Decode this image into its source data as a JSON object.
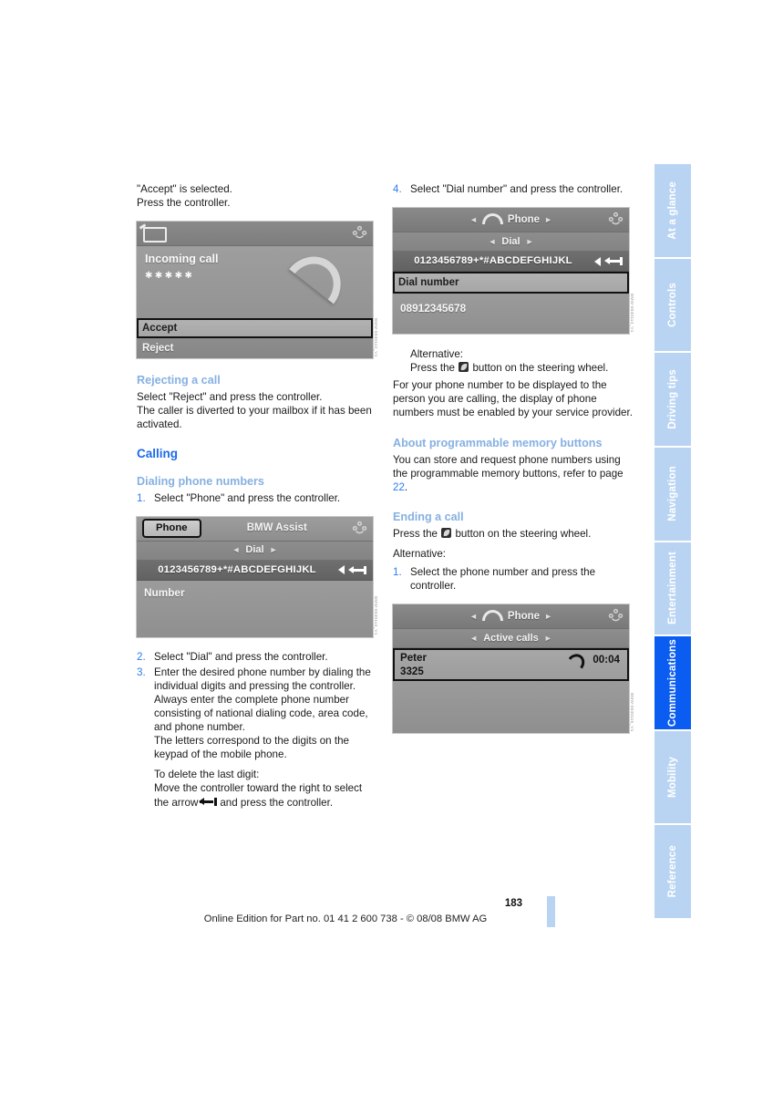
{
  "document": {
    "page_number": "183",
    "footer_text": "Online Edition for Part no. 01 41 2 600 738 - © 08/08 BMW AG"
  },
  "side_tabs": [
    {
      "label": "At a glance",
      "active": false
    },
    {
      "label": "Controls",
      "active": false
    },
    {
      "label": "Driving tips",
      "active": false
    },
    {
      "label": "Navigation",
      "active": false
    },
    {
      "label": "Entertainment",
      "active": false
    },
    {
      "label": "Communications",
      "active": true
    },
    {
      "label": "Mobility",
      "active": false
    },
    {
      "label": "Reference",
      "active": false
    }
  ],
  "colors": {
    "heading_major": "#1b6be8",
    "heading_minor": "#86b0e2",
    "step_number": "#2c7bf0",
    "tab_inactive": "#b9d4f3",
    "tab_active": "#0a5df0"
  },
  "left_column": {
    "intro_line_1": "\"Accept\" is selected.",
    "intro_line_2": "Press the controller.",
    "incoming_call_screen": {
      "title": "Incoming call",
      "masked_number": "✱✱✱✱✱",
      "row_accept": "Accept",
      "row_reject": "Reject",
      "credit": "BMW-0040112_V1"
    },
    "rejecting_heading": "Rejecting a call",
    "rejecting_body_1": "Select \"Reject\" and press the controller.",
    "rejecting_body_2": "The caller is diverted to your mailbox if it has been activated.",
    "calling_heading": "Calling",
    "dialing_heading": "Dialing phone numbers",
    "step1_num": "1.",
    "step1_text": "Select \"Phone\" and press the controller.",
    "dial_screen": {
      "tab_phone": "Phone",
      "label_bmw_assist": "BMW Assist",
      "subbar": "Dial",
      "charstrip": "0123456789+*#ABCDEFGHIJKL",
      "field_label": "Number",
      "credit": "BMW-0040113_V1"
    },
    "step2_num": "2.",
    "step2_text": "Select \"Dial\" and press the controller.",
    "step3_num": "3.",
    "step3_text": "Enter the desired phone number by dialing the individual digits and pressing the controller.",
    "step3_para2": "Always enter the complete phone number consisting of national dialing code, area code, and phone number.",
    "step3_para3": "The letters correspond to the digits on the keypad of the mobile phone.",
    "step3_para4_line1": "To delete the last digit:",
    "step3_para4_line2_a": "Move the controller toward the right to select the arrow",
    "step3_para4_line2_b": "and press the controller."
  },
  "right_column": {
    "step4_num": "4.",
    "step4_text": "Select \"Dial number\" and press the controller.",
    "dial_number_screen": {
      "topbar_title": "Phone",
      "subbar": "Dial",
      "charstrip": "0123456789+*#ABCDEFGHIJKL",
      "selected_row": "Dial number",
      "entered_number": "08912345678",
      "credit": "BMW-0040114_V1"
    },
    "alternative_label": "Alternative:",
    "alternative_text_a": "Press the",
    "alternative_text_b": "button on the steering wheel.",
    "display_note": "For your phone number to be displayed to the person you are calling, the display of phone numbers must be enabled by your service provider.",
    "memory_heading": "About programmable memory buttons",
    "memory_body_a": "You can store and request phone numbers using the programmable memory buttons, refer to page",
    "memory_page_ref": "22",
    "ending_heading": "Ending a call",
    "ending_text_a": "Press the",
    "ending_text_b": "button on the steering wheel.",
    "ending_alternative_label": "Alternative:",
    "ending_step1_num": "1.",
    "ending_step1_text": "Select the phone number and press the controller.",
    "active_call_screen": {
      "topbar_title": "Phone",
      "subbar": "Active calls",
      "caller_name": "Peter",
      "caller_number": "3325",
      "duration": "00:04",
      "credit": "BMW-0040115_V1"
    }
  }
}
